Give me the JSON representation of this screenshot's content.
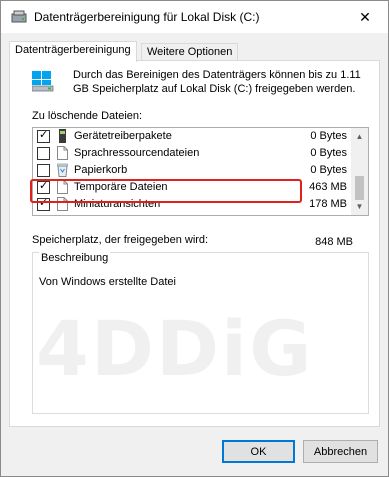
{
  "window": {
    "title": "Datenträgerbereinigung für Lokal Disk (C:)",
    "close_glyph": "✕"
  },
  "tabs": [
    {
      "label": "Datenträgerbereinigung",
      "active": true
    },
    {
      "label": "Weitere Optionen",
      "active": false
    }
  ],
  "intro": {
    "text": "Durch das Bereinigen des Datenträgers können bis zu 1.11 GB Speicherplatz auf Lokal Disk (C:) freigegeben werden."
  },
  "list": {
    "label": "Zu löschende Dateien:",
    "items": [
      {
        "name": "Gerätetreiberpakete",
        "size": "0 Bytes",
        "checked": true,
        "icon": "driver-package-icon"
      },
      {
        "name": "Sprachressourcendateien",
        "size": "0 Bytes",
        "checked": false,
        "icon": "file-icon"
      },
      {
        "name": "Papierkorb",
        "size": "0 Bytes",
        "checked": false,
        "icon": "recycle-bin-icon"
      },
      {
        "name": "Temporäre Dateien",
        "size": "463 MB",
        "checked": true,
        "icon": "file-icon"
      },
      {
        "name": "Miniaturansichten",
        "size": "178 MB",
        "checked": true,
        "icon": "file-icon"
      }
    ],
    "scroll_position": 0.62
  },
  "space": {
    "label": "Speicherplatz, der freigegeben wird:",
    "value": "848 MB"
  },
  "description": {
    "title": "Beschreibung",
    "text": "Von Windows erstellte Datei"
  },
  "watermark": {
    "text": "4DDiG"
  },
  "buttons": {
    "ok": "OK",
    "cancel": "Abbrechen"
  },
  "colors": {
    "highlight": "#e0201c",
    "accent": "#0078d7"
  }
}
